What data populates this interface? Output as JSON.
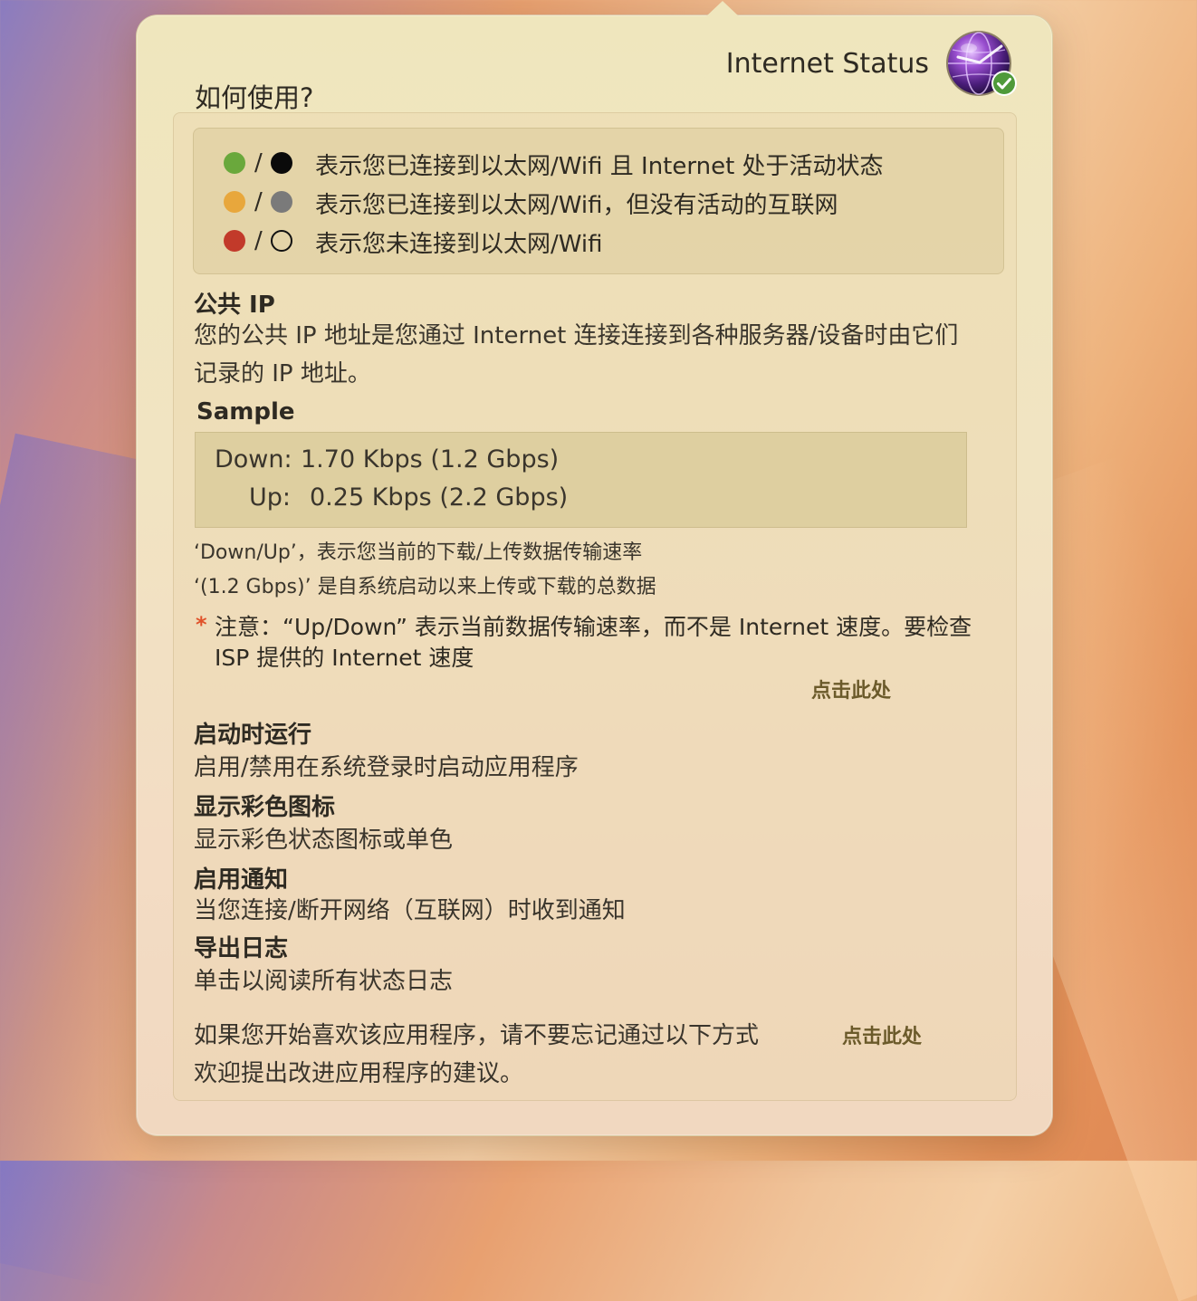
{
  "app": {
    "title": "Internet Status"
  },
  "howto": {
    "title": "如何使用?"
  },
  "legend": {
    "rows": [
      {
        "dot_color": "#6aa83c",
        "alt_color": "#0a0a0a",
        "alt_hollow": false,
        "separator": "/",
        "text": "表示您已连接到以太网/Wifi 且 Internet 处于活动状态"
      },
      {
        "dot_color": "#e8a73c",
        "alt_color": "#7a7a7a",
        "alt_hollow": false,
        "separator": "/",
        "text": "表示您已连接到以太网/Wifi，但没有活动的互联网"
      },
      {
        "dot_color": "#c23a2a",
        "alt_color": "#ffffff",
        "alt_hollow": true,
        "separator": "/",
        "text": "表示您未连接到以太网/Wifi"
      }
    ]
  },
  "public_ip": {
    "title": "公共 IP",
    "desc_line1": "您的公共 IP 地址是您通过 Internet 连接连接到各种服务器/设备时由它们",
    "desc_line2": "记录的 IP 地址。"
  },
  "sample": {
    "title": "Sample",
    "down_label": "Down:",
    "down_value": "1.70 Kbps (1.2 Gbps)",
    "up_label": "Up:",
    "up_value": "0.25 Kbps (2.2 Gbps)",
    "note1": "‘Down/Up’，表示您当前的下载/上传数据传输速率",
    "note2": "‘(1.2 Gbps)’ 是自系统启动以来上传或下载的总数据"
  },
  "warning": {
    "asterisk": "*",
    "line1": "注意：“Up/Down” 表示当前数据传输速率，而不是 Internet 速度。要检查",
    "line2": "ISP 提供的 Internet 速度",
    "link": "点击此处"
  },
  "features": [
    {
      "title": "启动时运行",
      "desc": "启用/禁用在系统登录时启动应用程序"
    },
    {
      "title": "显示彩色图标",
      "desc": "显示彩色状态图标或单色"
    },
    {
      "title": "启用通知",
      "desc": "当您连接/断开网络（互联网）时收到通知"
    },
    {
      "title": "导出日志",
      "desc": "单击以阅读所有状态日志"
    }
  ],
  "feedback": {
    "line1": "如果您开始喜欢该应用程序，请不要忘记通过以下方式",
    "line2": "欢迎提出改进应用程序的建议。",
    "link": "点击此处"
  },
  "colors": {
    "text": "#2e2a22",
    "link": "#6b5a2a",
    "asterisk": "#e0522a",
    "badge_green": "#4f9a3a"
  },
  "icons": {
    "app_icon": "globe-icon",
    "status_badge": "checkmark-badge-icon"
  }
}
